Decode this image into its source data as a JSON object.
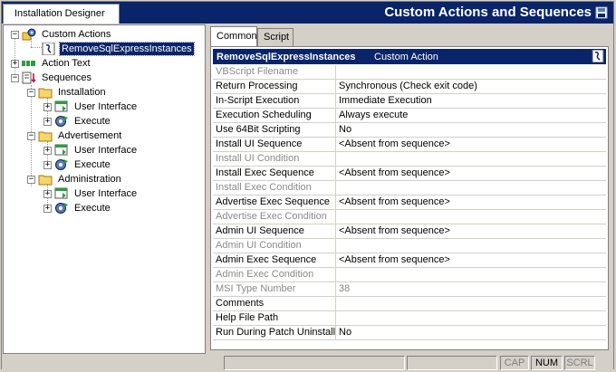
{
  "header": {
    "designer_tab": "Installation Designer",
    "title": "Custom Actions and Sequences"
  },
  "tree": {
    "custom_actions": "Custom Actions",
    "custom_action_item": "RemoveSqlExpressInstances",
    "action_text": "Action Text",
    "sequences": "Sequences",
    "installation": "Installation",
    "advertisement": "Advertisement",
    "administration": "Administration",
    "user_interface": "User Interface",
    "execute": "Execute"
  },
  "tabs": {
    "common": "Common",
    "script": "Script"
  },
  "grid": {
    "header_name": "RemoveSqlExpressInstances",
    "header_type": "Custom Action",
    "rows": [
      {
        "name": "VBScript Filename",
        "value": "",
        "disabled": true
      },
      {
        "name": "Return Processing",
        "value": "Synchronous (Check exit code)",
        "disabled": false
      },
      {
        "name": "In-Script Execution",
        "value": "Immediate Execution",
        "disabled": false
      },
      {
        "name": "Execution Scheduling",
        "value": "Always execute",
        "disabled": false
      },
      {
        "name": "Use 64Bit Scripting",
        "value": "No",
        "disabled": false
      },
      {
        "name": "Install UI Sequence",
        "value": "<Absent from sequence>",
        "disabled": false
      },
      {
        "name": "Install UI Condition",
        "value": "",
        "disabled": true
      },
      {
        "name": "Install Exec Sequence",
        "value": "<Absent from sequence>",
        "disabled": false
      },
      {
        "name": "Install Exec Condition",
        "value": "",
        "disabled": true
      },
      {
        "name": "Advertise Exec Sequence",
        "value": "<Absent from sequence>",
        "disabled": false
      },
      {
        "name": "Advertise Exec Condition",
        "value": "",
        "disabled": true
      },
      {
        "name": "Admin UI Sequence",
        "value": "<Absent from sequence>",
        "disabled": false
      },
      {
        "name": "Admin UI Condition",
        "value": "",
        "disabled": true
      },
      {
        "name": "Admin Exec Sequence",
        "value": "<Absent from sequence>",
        "disabled": false
      },
      {
        "name": "Admin Exec Condition",
        "value": "",
        "disabled": true
      },
      {
        "name": "MSI Type Number",
        "value": "38",
        "disabled": true
      },
      {
        "name": "Comments",
        "value": "",
        "disabled": false
      },
      {
        "name": "Help File Path",
        "value": "",
        "disabled": false
      },
      {
        "name": "Run During Patch Uninstall",
        "value": "No",
        "disabled": false
      }
    ]
  },
  "status": {
    "cap": "CAP",
    "num": "NUM",
    "scrl": "SCRL"
  },
  "colors": {
    "header_bg": "#0a246a",
    "selection": "#0a246a",
    "disabled_text": "#8a8a8a"
  }
}
